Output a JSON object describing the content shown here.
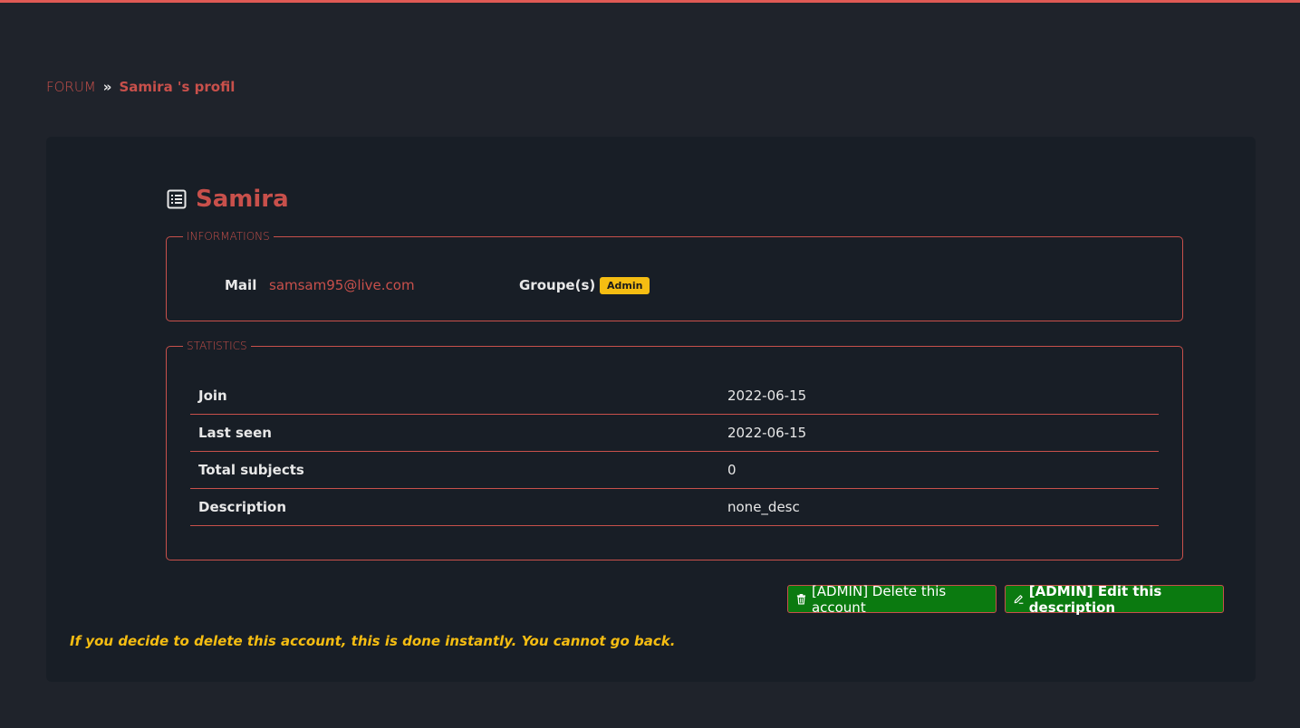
{
  "breadcrumb": {
    "root": "FORUM",
    "separator": "»",
    "current": "Samira 's profil"
  },
  "profile": {
    "name": "Samira",
    "title_icon": "list-alt-icon"
  },
  "informations": {
    "legend": "INFORMATIONS",
    "mail_label": "Mail",
    "mail_value": "samsam95@live.com",
    "groups_label": "Groupe(s)",
    "group_badge": "Admin"
  },
  "statistics": {
    "legend": "STATISTICS",
    "rows": [
      {
        "label": "Join",
        "value": "2022-06-15"
      },
      {
        "label": "Last seen",
        "value": "2022-06-15"
      },
      {
        "label": "Total subjects",
        "value": "0"
      },
      {
        "label": "Description",
        "value": "none_desc"
      }
    ]
  },
  "actions": {
    "delete_label": "[ADMIN] Delete this account",
    "edit_label": "[ADMIN] Edit this description"
  },
  "warning": "If you decide to delete this account, this is done instantly. You cannot go back.",
  "colors": {
    "accent": "#c8504b",
    "button_green": "#0b7a10",
    "badge_yellow": "#f5bd12",
    "background": "#1f232b",
    "card": "#181e26"
  }
}
